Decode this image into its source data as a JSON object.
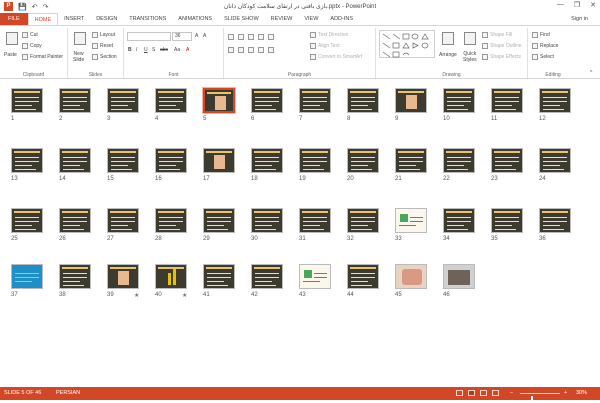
{
  "window": {
    "title": "بازی بافتی در ارتقای سلامت کودکان دانان.pptx - PowerPoint",
    "minimize": "—",
    "restore": "❐",
    "close": "✕"
  },
  "qat": {
    "app_icon": "P",
    "save": "💾",
    "undo": "↶",
    "redo": "↷"
  },
  "tabs": [
    {
      "label": "FILE"
    },
    {
      "label": "HOME"
    },
    {
      "label": "INSERT"
    },
    {
      "label": "DESIGN"
    },
    {
      "label": "TRANSITIONS"
    },
    {
      "label": "ANIMATIONS"
    },
    {
      "label": "SLIDE SHOW"
    },
    {
      "label": "REVIEW"
    },
    {
      "label": "VIEW"
    },
    {
      "label": "ADD-INS"
    }
  ],
  "account": {
    "label": "Sign in"
  },
  "ribbon": {
    "clipboard": {
      "label": "Clipboard",
      "paste": "Paste",
      "cut": "Cut",
      "copy": "Copy",
      "format_painter": "Format Painter"
    },
    "slides": {
      "label": "Slides",
      "new_slide": "New",
      "new_slide2": "Slide",
      "layout": "Layout",
      "reset": "Reset",
      "section": "Section"
    },
    "font": {
      "label": "Font",
      "size": "36",
      "grow": "A",
      "shrink": "A",
      "bold": "B",
      "italic": "I",
      "underline": "U",
      "shadow": "S",
      "strike": "abc",
      "aa": "Aa",
      "color": "A"
    },
    "paragraph": {
      "label": "Paragraph",
      "text_direction": "Text Direction",
      "align_text": "Align Text",
      "convert_smartart": "Convert to SmartArt"
    },
    "drawing": {
      "label": "Drawing",
      "arrange": "Arrange",
      "quick_styles": "Quick",
      "quick_styles2": "Styles",
      "shape_fill": "Shape Fill",
      "shape_outline": "Shape Outline",
      "shape_effects": "Shape Effects"
    },
    "editing": {
      "label": "Editing",
      "find": "Find",
      "replace": "Replace",
      "select": "Select"
    }
  },
  "slides": [
    {
      "n": "1",
      "kind": "text"
    },
    {
      "n": "2",
      "kind": "text"
    },
    {
      "n": "3",
      "kind": "text"
    },
    {
      "n": "4",
      "kind": "text"
    },
    {
      "n": "5",
      "kind": "pic",
      "selected": true
    },
    {
      "n": "6",
      "kind": "text"
    },
    {
      "n": "7",
      "kind": "text"
    },
    {
      "n": "8",
      "kind": "text"
    },
    {
      "n": "9",
      "kind": "pic"
    },
    {
      "n": "10",
      "kind": "text"
    },
    {
      "n": "11",
      "kind": "text"
    },
    {
      "n": "12",
      "kind": "text"
    },
    {
      "n": "13",
      "kind": "text"
    },
    {
      "n": "14",
      "kind": "text"
    },
    {
      "n": "15",
      "kind": "text"
    },
    {
      "n": "16",
      "kind": "text"
    },
    {
      "n": "17",
      "kind": "pic"
    },
    {
      "n": "18",
      "kind": "text"
    },
    {
      "n": "19",
      "kind": "text"
    },
    {
      "n": "20",
      "kind": "text"
    },
    {
      "n": "21",
      "kind": "text"
    },
    {
      "n": "22",
      "kind": "text"
    },
    {
      "n": "23",
      "kind": "text"
    },
    {
      "n": "24",
      "kind": "text"
    },
    {
      "n": "25",
      "kind": "text"
    },
    {
      "n": "26",
      "kind": "text"
    },
    {
      "n": "27",
      "kind": "text"
    },
    {
      "n": "28",
      "kind": "text"
    },
    {
      "n": "29",
      "kind": "text"
    },
    {
      "n": "30",
      "kind": "text"
    },
    {
      "n": "31",
      "kind": "text"
    },
    {
      "n": "32",
      "kind": "text"
    },
    {
      "n": "33",
      "kind": "white"
    },
    {
      "n": "34",
      "kind": "text"
    },
    {
      "n": "35",
      "kind": "text"
    },
    {
      "n": "36",
      "kind": "text"
    },
    {
      "n": "37",
      "kind": "blue"
    },
    {
      "n": "38",
      "kind": "text"
    },
    {
      "n": "39",
      "kind": "pic",
      "star": true
    },
    {
      "n": "40",
      "kind": "chart",
      "star": true
    },
    {
      "n": "41",
      "kind": "text"
    },
    {
      "n": "42",
      "kind": "text"
    },
    {
      "n": "43",
      "kind": "white"
    },
    {
      "n": "44",
      "kind": "text"
    },
    {
      "n": "45",
      "kind": "photo1"
    },
    {
      "n": "46",
      "kind": "photo2"
    }
  ],
  "status": {
    "slide_info": "SLIDE 5 OF 46",
    "language": "PERSIAN",
    "zoom_out": "−",
    "zoom_in": "+",
    "zoom": "30%",
    "zoom_fraction": 0.3
  },
  "colors": {
    "accent": "#d24726",
    "slide_bg": "#3d3a30"
  }
}
